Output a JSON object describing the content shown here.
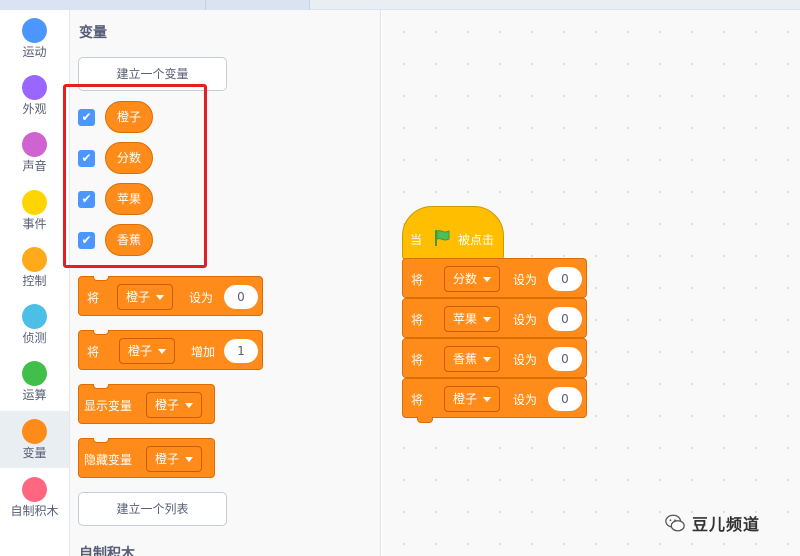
{
  "categories": [
    {
      "label": "运动",
      "color": "#4c97ff"
    },
    {
      "label": "外观",
      "color": "#9966ff"
    },
    {
      "label": "声音",
      "color": "#cf63cf"
    },
    {
      "label": "事件",
      "color": "#ffd500"
    },
    {
      "label": "控制",
      "color": "#ffab19"
    },
    {
      "label": "侦测",
      "color": "#4cbfe6"
    },
    {
      "label": "运算",
      "color": "#40bf4a"
    },
    {
      "label": "变量",
      "color": "#ff8c1a"
    },
    {
      "label": "自制积木",
      "color": "#ff6680"
    }
  ],
  "selected_category": "变量",
  "palette": {
    "section_title": "变量",
    "make_variable_label": "建立一个变量",
    "variables": [
      {
        "name": "橙子",
        "checked": true
      },
      {
        "name": "分数",
        "checked": true
      },
      {
        "name": "苹果",
        "checked": true
      },
      {
        "name": "香蕉",
        "checked": true
      }
    ],
    "set_block": {
      "prefix": "将",
      "var": "橙子",
      "op": "设为",
      "value": "0"
    },
    "change_block": {
      "prefix": "将",
      "var": "橙子",
      "op": "增加",
      "value": "1"
    },
    "show_block": {
      "label": "显示变量",
      "var": "橙子"
    },
    "hide_block": {
      "label": "隐藏变量",
      "var": "橙子"
    },
    "make_list_label": "建立一个列表",
    "next_section_title": "自制积木"
  },
  "workspace": {
    "hat": {
      "prefix": "当",
      "icon": "green-flag-icon",
      "suffix": "被点击"
    },
    "blocks": [
      {
        "prefix": "将",
        "var": "分数",
        "op": "设为",
        "value": "0"
      },
      {
        "prefix": "将",
        "var": "苹果",
        "op": "设为",
        "value": "0"
      },
      {
        "prefix": "将",
        "var": "香蕉",
        "op": "设为",
        "value": "0"
      },
      {
        "prefix": "将",
        "var": "橙子",
        "op": "设为",
        "value": "0"
      }
    ]
  },
  "watermark": {
    "text": "豆儿频道"
  },
  "colors": {
    "variables": "#ff8c1a",
    "events": "#ffbf00",
    "highlight": "#e41f23",
    "checkbox": "#4c97ff"
  }
}
